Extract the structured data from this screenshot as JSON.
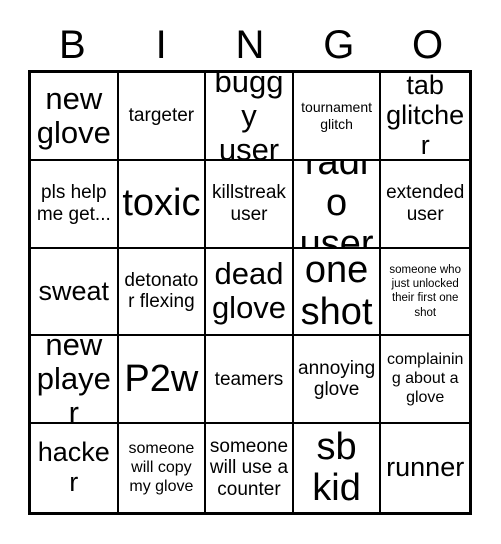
{
  "card": {
    "title": "BINGO",
    "header_letters": [
      "B",
      "I",
      "N",
      "G",
      "O"
    ],
    "background_color": "#ffffff",
    "line_color": "#000000",
    "grid": {
      "columns": 5,
      "rows": 5
    },
    "cells": [
      {
        "text": "new glove",
        "size": "s-xl"
      },
      {
        "text": "targeter",
        "size": "s-md"
      },
      {
        "text": "buggy user",
        "size": "s-xl"
      },
      {
        "text": "tournament glitch",
        "size": "s-xs"
      },
      {
        "text": "tab glitcher",
        "size": "s-lg"
      },
      {
        "text": "pls help me get...",
        "size": "s-md"
      },
      {
        "text": "toxic",
        "size": "s-xxl"
      },
      {
        "text": "killstreak user",
        "size": "s-md"
      },
      {
        "text": "radio user",
        "size": "s-xxl"
      },
      {
        "text": "extended user",
        "size": "s-md"
      },
      {
        "text": "sweat",
        "size": "s-lg"
      },
      {
        "text": "detonator flexing",
        "size": "s-md"
      },
      {
        "text": "dead glove",
        "size": "s-xl"
      },
      {
        "text": "one shot",
        "size": "s-xxl"
      },
      {
        "text": "someone who just unlocked their first one shot",
        "size": "s-xxs"
      },
      {
        "text": "new player",
        "size": "s-xl"
      },
      {
        "text": "P2w",
        "size": "s-xxl"
      },
      {
        "text": "teamers",
        "size": "s-md"
      },
      {
        "text": "annoying glove",
        "size": "s-md"
      },
      {
        "text": "complaining about a glove",
        "size": "s-sm"
      },
      {
        "text": "hacker",
        "size": "s-lg"
      },
      {
        "text": "someone will copy my glove",
        "size": "s-sm"
      },
      {
        "text": "someone will use a counter",
        "size": "s-md"
      },
      {
        "text": "sb kid",
        "size": "s-xxl"
      },
      {
        "text": "runner",
        "size": "s-lg"
      }
    ]
  }
}
